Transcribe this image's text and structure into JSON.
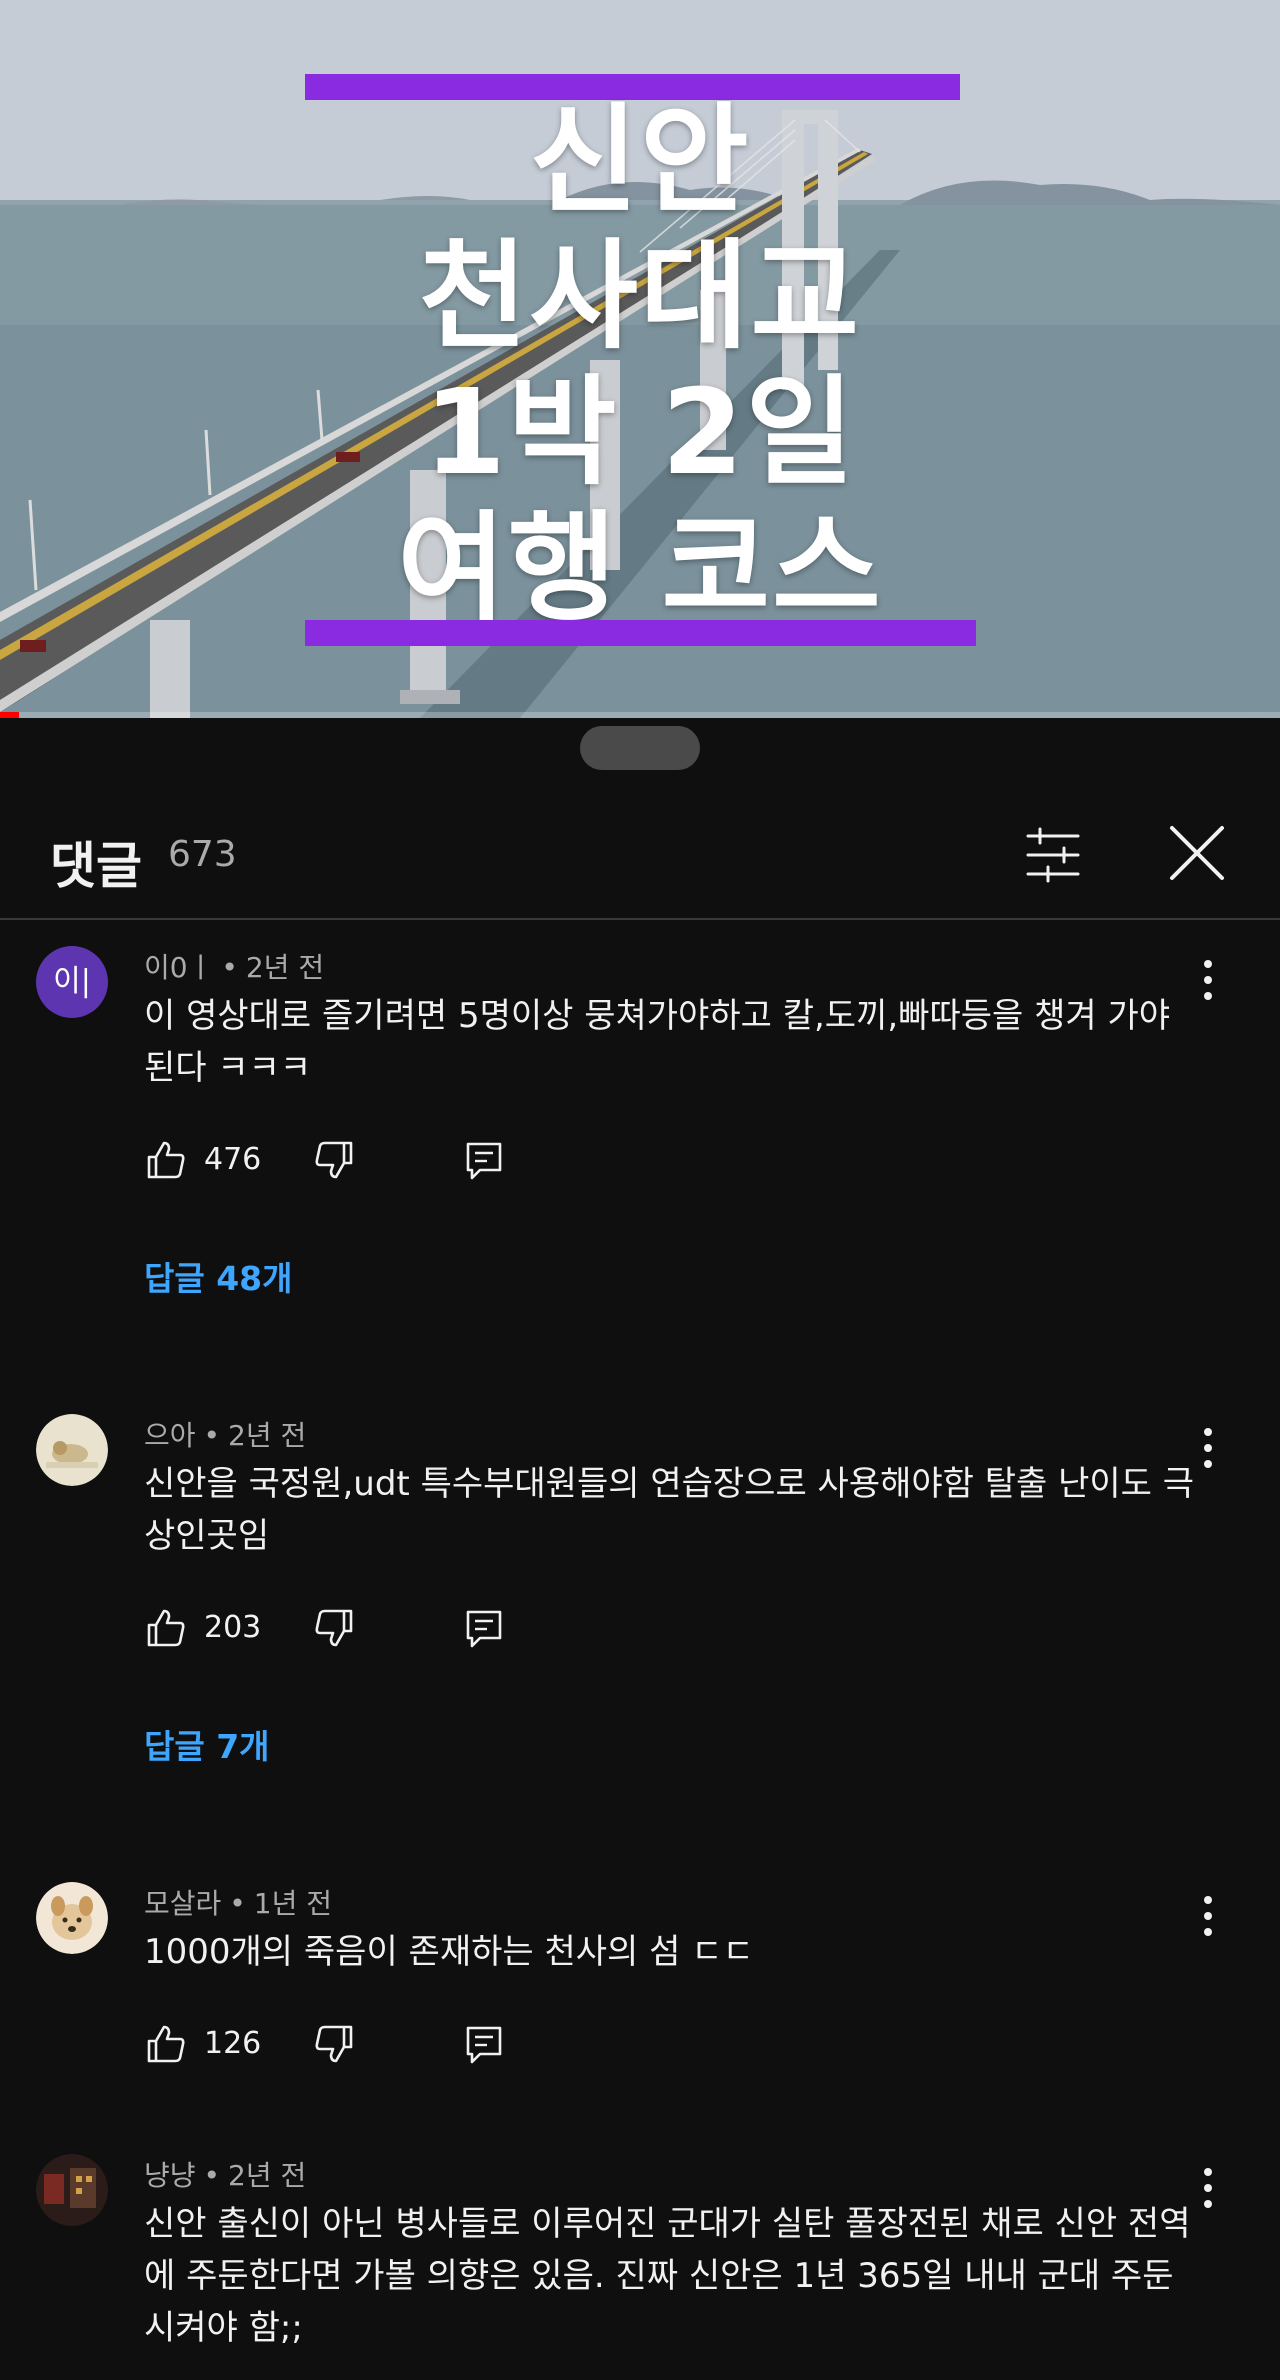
{
  "video": {
    "title_lines": [
      "신안",
      "천사대교",
      "1박 2일",
      "여행 코스"
    ],
    "accent_color": "#8a2be2",
    "progress": 0.015
  },
  "comments_panel": {
    "title": "댓글",
    "count": "673",
    "filter_icon": "sliders-icon",
    "close_icon": "close-icon"
  },
  "comments": [
    {
      "avatar_letter": "이|",
      "author": "이0ㅣ",
      "time": "2년 전",
      "text": "이 영상대로 즐기려면 5명이상 뭉쳐가야하고 칼,도끼,빠따등을 챙겨 가야된다 ㅋㅋㅋ",
      "likes": "476",
      "replies": "답글 48개"
    },
    {
      "avatar_letter": "",
      "author": "으아",
      "time": "2년 전",
      "text": "신안을 국정원,udt 특수부대원들의 연습장으로 사용해야함 탈출 난이도 극상인곳임",
      "likes": "203",
      "replies": "답글 7개"
    },
    {
      "avatar_letter": "",
      "author": "모살라",
      "time": "1년 전",
      "text": "1000개의 죽음이 존재하는 천사의 섬 ㄷㄷ",
      "likes": "126",
      "replies": ""
    },
    {
      "avatar_letter": "",
      "author": "냥냥",
      "time": "2년 전",
      "text": "신안 출신이 아닌 병사들로 이루어진 군대가 실탄 풀장전된 채로 신안 전역에 주둔한다면 가볼 의향은 있음. 진짜 신안은 1년 365일 내내 군대 주둔시켜야 함;;",
      "likes": "",
      "replies": ""
    }
  ]
}
